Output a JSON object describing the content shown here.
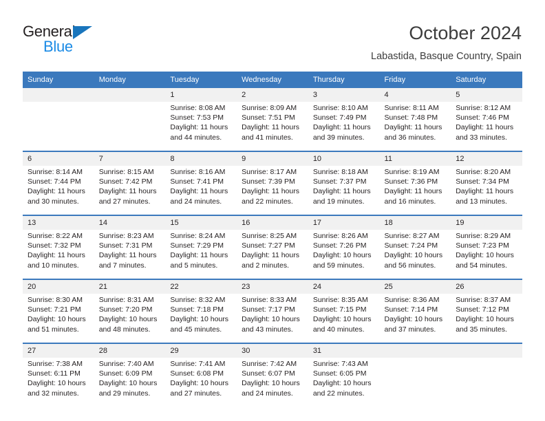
{
  "logo": {
    "word_one": "General",
    "word_two": "Blue",
    "triangle_color": "#1975bc",
    "blue_color": "#1a8ae5"
  },
  "header": {
    "title": "October 2024",
    "location": "Labastida, Basque Country, Spain"
  },
  "theme": {
    "header_blue": "#3b79bd",
    "date_band_gray": "#f1f1f1",
    "text_color": "#231f20"
  },
  "weekday_headers": [
    "Sunday",
    "Monday",
    "Tuesday",
    "Wednesday",
    "Thursday",
    "Friday",
    "Saturday"
  ],
  "weeks": [
    {
      "days": [
        {
          "date": "",
          "lines": []
        },
        {
          "date": "",
          "lines": []
        },
        {
          "date": "1",
          "lines": [
            "Sunrise: 8:08 AM",
            "Sunset: 7:53 PM",
            "Daylight: 11 hours",
            "and 44 minutes."
          ]
        },
        {
          "date": "2",
          "lines": [
            "Sunrise: 8:09 AM",
            "Sunset: 7:51 PM",
            "Daylight: 11 hours",
            "and 41 minutes."
          ]
        },
        {
          "date": "3",
          "lines": [
            "Sunrise: 8:10 AM",
            "Sunset: 7:49 PM",
            "Daylight: 11 hours",
            "and 39 minutes."
          ]
        },
        {
          "date": "4",
          "lines": [
            "Sunrise: 8:11 AM",
            "Sunset: 7:48 PM",
            "Daylight: 11 hours",
            "and 36 minutes."
          ]
        },
        {
          "date": "5",
          "lines": [
            "Sunrise: 8:12 AM",
            "Sunset: 7:46 PM",
            "Daylight: 11 hours",
            "and 33 minutes."
          ]
        }
      ]
    },
    {
      "days": [
        {
          "date": "6",
          "lines": [
            "Sunrise: 8:14 AM",
            "Sunset: 7:44 PM",
            "Daylight: 11 hours",
            "and 30 minutes."
          ]
        },
        {
          "date": "7",
          "lines": [
            "Sunrise: 8:15 AM",
            "Sunset: 7:42 PM",
            "Daylight: 11 hours",
            "and 27 minutes."
          ]
        },
        {
          "date": "8",
          "lines": [
            "Sunrise: 8:16 AM",
            "Sunset: 7:41 PM",
            "Daylight: 11 hours",
            "and 24 minutes."
          ]
        },
        {
          "date": "9",
          "lines": [
            "Sunrise: 8:17 AM",
            "Sunset: 7:39 PM",
            "Daylight: 11 hours",
            "and 22 minutes."
          ]
        },
        {
          "date": "10",
          "lines": [
            "Sunrise: 8:18 AM",
            "Sunset: 7:37 PM",
            "Daylight: 11 hours",
            "and 19 minutes."
          ]
        },
        {
          "date": "11",
          "lines": [
            "Sunrise: 8:19 AM",
            "Sunset: 7:36 PM",
            "Daylight: 11 hours",
            "and 16 minutes."
          ]
        },
        {
          "date": "12",
          "lines": [
            "Sunrise: 8:20 AM",
            "Sunset: 7:34 PM",
            "Daylight: 11 hours",
            "and 13 minutes."
          ]
        }
      ]
    },
    {
      "days": [
        {
          "date": "13",
          "lines": [
            "Sunrise: 8:22 AM",
            "Sunset: 7:32 PM",
            "Daylight: 11 hours",
            "and 10 minutes."
          ]
        },
        {
          "date": "14",
          "lines": [
            "Sunrise: 8:23 AM",
            "Sunset: 7:31 PM",
            "Daylight: 11 hours",
            "and 7 minutes."
          ]
        },
        {
          "date": "15",
          "lines": [
            "Sunrise: 8:24 AM",
            "Sunset: 7:29 PM",
            "Daylight: 11 hours",
            "and 5 minutes."
          ]
        },
        {
          "date": "16",
          "lines": [
            "Sunrise: 8:25 AM",
            "Sunset: 7:27 PM",
            "Daylight: 11 hours",
            "and 2 minutes."
          ]
        },
        {
          "date": "17",
          "lines": [
            "Sunrise: 8:26 AM",
            "Sunset: 7:26 PM",
            "Daylight: 10 hours",
            "and 59 minutes."
          ]
        },
        {
          "date": "18",
          "lines": [
            "Sunrise: 8:27 AM",
            "Sunset: 7:24 PM",
            "Daylight: 10 hours",
            "and 56 minutes."
          ]
        },
        {
          "date": "19",
          "lines": [
            "Sunrise: 8:29 AM",
            "Sunset: 7:23 PM",
            "Daylight: 10 hours",
            "and 54 minutes."
          ]
        }
      ]
    },
    {
      "days": [
        {
          "date": "20",
          "lines": [
            "Sunrise: 8:30 AM",
            "Sunset: 7:21 PM",
            "Daylight: 10 hours",
            "and 51 minutes."
          ]
        },
        {
          "date": "21",
          "lines": [
            "Sunrise: 8:31 AM",
            "Sunset: 7:20 PM",
            "Daylight: 10 hours",
            "and 48 minutes."
          ]
        },
        {
          "date": "22",
          "lines": [
            "Sunrise: 8:32 AM",
            "Sunset: 7:18 PM",
            "Daylight: 10 hours",
            "and 45 minutes."
          ]
        },
        {
          "date": "23",
          "lines": [
            "Sunrise: 8:33 AM",
            "Sunset: 7:17 PM",
            "Daylight: 10 hours",
            "and 43 minutes."
          ]
        },
        {
          "date": "24",
          "lines": [
            "Sunrise: 8:35 AM",
            "Sunset: 7:15 PM",
            "Daylight: 10 hours",
            "and 40 minutes."
          ]
        },
        {
          "date": "25",
          "lines": [
            "Sunrise: 8:36 AM",
            "Sunset: 7:14 PM",
            "Daylight: 10 hours",
            "and 37 minutes."
          ]
        },
        {
          "date": "26",
          "lines": [
            "Sunrise: 8:37 AM",
            "Sunset: 7:12 PM",
            "Daylight: 10 hours",
            "and 35 minutes."
          ]
        }
      ]
    },
    {
      "days": [
        {
          "date": "27",
          "lines": [
            "Sunrise: 7:38 AM",
            "Sunset: 6:11 PM",
            "Daylight: 10 hours",
            "and 32 minutes."
          ]
        },
        {
          "date": "28",
          "lines": [
            "Sunrise: 7:40 AM",
            "Sunset: 6:09 PM",
            "Daylight: 10 hours",
            "and 29 minutes."
          ]
        },
        {
          "date": "29",
          "lines": [
            "Sunrise: 7:41 AM",
            "Sunset: 6:08 PM",
            "Daylight: 10 hours",
            "and 27 minutes."
          ]
        },
        {
          "date": "30",
          "lines": [
            "Sunrise: 7:42 AM",
            "Sunset: 6:07 PM",
            "Daylight: 10 hours",
            "and 24 minutes."
          ]
        },
        {
          "date": "31",
          "lines": [
            "Sunrise: 7:43 AM",
            "Sunset: 6:05 PM",
            "Daylight: 10 hours",
            "and 22 minutes."
          ]
        },
        {
          "date": "",
          "lines": []
        },
        {
          "date": "",
          "lines": []
        }
      ]
    }
  ]
}
